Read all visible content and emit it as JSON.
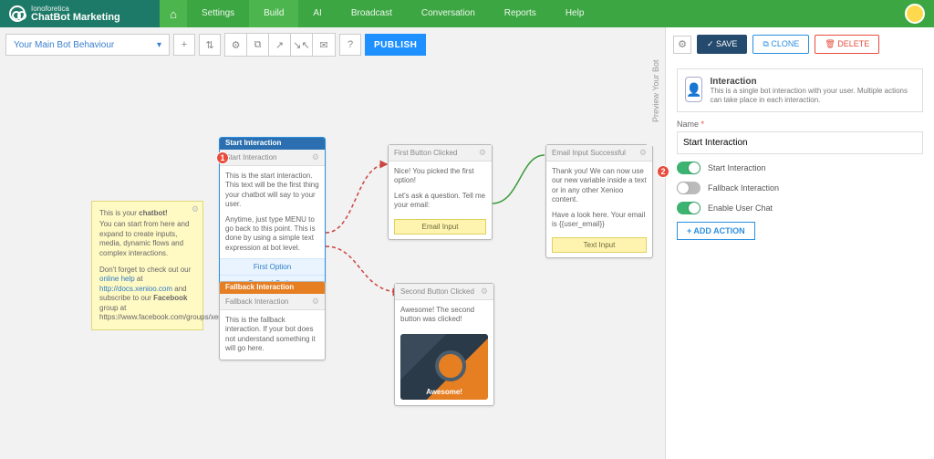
{
  "brand": {
    "top_line": "Ionoforetica",
    "name": "ChatBot Marketing"
  },
  "nav": {
    "settings": "Settings",
    "build": "Build",
    "ai": "AI",
    "broadcast": "Broadcast",
    "conversation": "Conversation",
    "reports": "Reports",
    "help": "Help"
  },
  "toolbar": {
    "behavior": "Your Main Bot Behaviour",
    "publish": "PUBLISH"
  },
  "hint": {
    "l1a": "This is your ",
    "l1b": "chatbot!",
    "l2": "You can start from here and expand to create inputs, media, dynamic flows and complex interactions.",
    "l3a": "Don't forget to check out our ",
    "l3b": "online help",
    "l3c": " at ",
    "l3d": "http://docs.xenioo.com",
    "l3e": " and subscribe to our ",
    "l3f": "Facebook",
    "l3g": " group at https://www.facebook.com/groups/xenioo"
  },
  "nodes": {
    "start": {
      "bar": "Start Interaction",
      "title": "Start Interaction",
      "p1": "This is the start interaction. This text will be the first thing your chatbot will say to your user.",
      "p2": "Anytime, just type MENU to go back to this point. This is done by using a simple text expression at bot level.",
      "opt1": "First Option",
      "opt2": "Second Option"
    },
    "fallback": {
      "bar": "Fallback Interaction",
      "title": "Fallback Interaction",
      "p": "This is the fallback interaction. If your bot does not understand something it will go here."
    },
    "first": {
      "title": "First Button Clicked",
      "p1": "Nice! You picked the first option!",
      "p2": "Let's ask a question. Tell me your email:",
      "btn": "Email Input"
    },
    "email": {
      "title": "Email Input Successful",
      "p1": "Thank you! We can now use our new variable inside a text or in any other Xenioo content.",
      "p2": "Have a look here. Your email is {{user_email}}",
      "btn": "Text Input"
    },
    "second": {
      "title": "Second Button Clicked",
      "p": "Awesome! The second button was clicked!",
      "caption": "Awesome!"
    }
  },
  "badges": {
    "one": "1",
    "two": "2"
  },
  "preview_tab": "Preview Your Bot",
  "side": {
    "save": "SAVE",
    "clone": "CLONE",
    "delete": "DELETE",
    "info_title": "Interaction",
    "info_desc": "This is a single bot interaction with your user. Multiple actions can take place in each interaction.",
    "name_label": "Name",
    "req": "*",
    "name_value": "Start Interaction",
    "t1": "Start Interaction",
    "t2": "Fallback Interaction",
    "t3": "Enable User Chat",
    "add": "+ ADD ACTION"
  }
}
